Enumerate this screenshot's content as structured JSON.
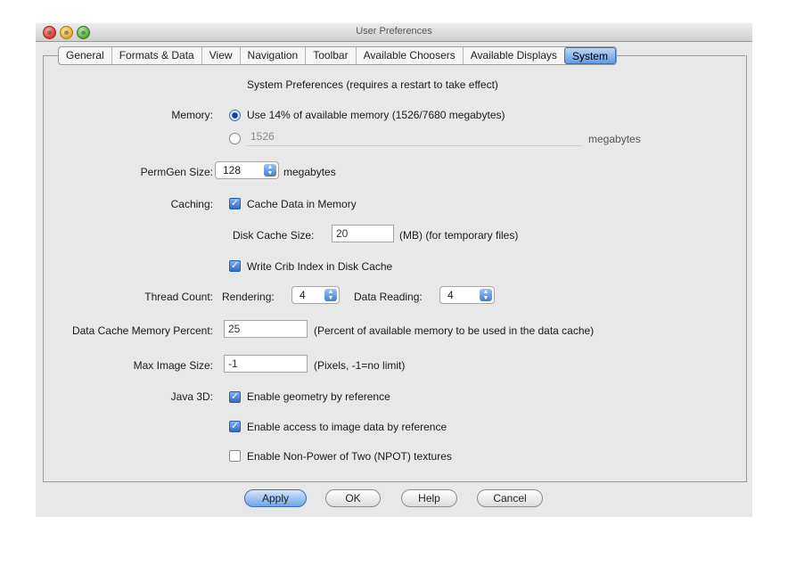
{
  "window": {
    "title": "User Preferences"
  },
  "tabs": [
    "General",
    "Formats & Data",
    "View",
    "Navigation",
    "Toolbar",
    "Available Choosers",
    "Available Displays",
    "System"
  ],
  "header": "System Preferences (requires a restart to take effect)",
  "memory": {
    "label": "Memory:",
    "option1_text": "Use 14% of available memory (1526/7680 megabytes)",
    "option2_value": "1526",
    "unit": "megabytes"
  },
  "permgen": {
    "label": "PermGen Size:",
    "value": "128",
    "unit": "megabytes"
  },
  "caching": {
    "label": "Caching:",
    "cache_data_label": "Cache Data in Memory",
    "disk_cache_label": "Disk Cache Size:",
    "disk_cache_value": "20",
    "disk_cache_note": "(MB) (for temporary files)",
    "crib_label": "Write Crib Index in Disk Cache"
  },
  "thread": {
    "label": "Thread Count:",
    "rendering_label": "Rendering:",
    "rendering_value": "4",
    "reading_label": "Data Reading:",
    "reading_value": "4"
  },
  "data_cache": {
    "label": "Data Cache Memory Percent:",
    "value": "25",
    "note": "(Percent of available memory to be used in the data cache)"
  },
  "max_image": {
    "label": "Max Image Size:",
    "value": "-1",
    "note": "(Pixels, -1=no limit)"
  },
  "java3d": {
    "label": "Java 3D:",
    "geometry_label": "Enable geometry by reference",
    "image_label": "Enable access to image data by reference",
    "npot_label": "Enable Non-Power of Two (NPOT) textures"
  },
  "buttons": {
    "apply": "Apply",
    "ok": "OK",
    "help": "Help",
    "cancel": "Cancel"
  }
}
